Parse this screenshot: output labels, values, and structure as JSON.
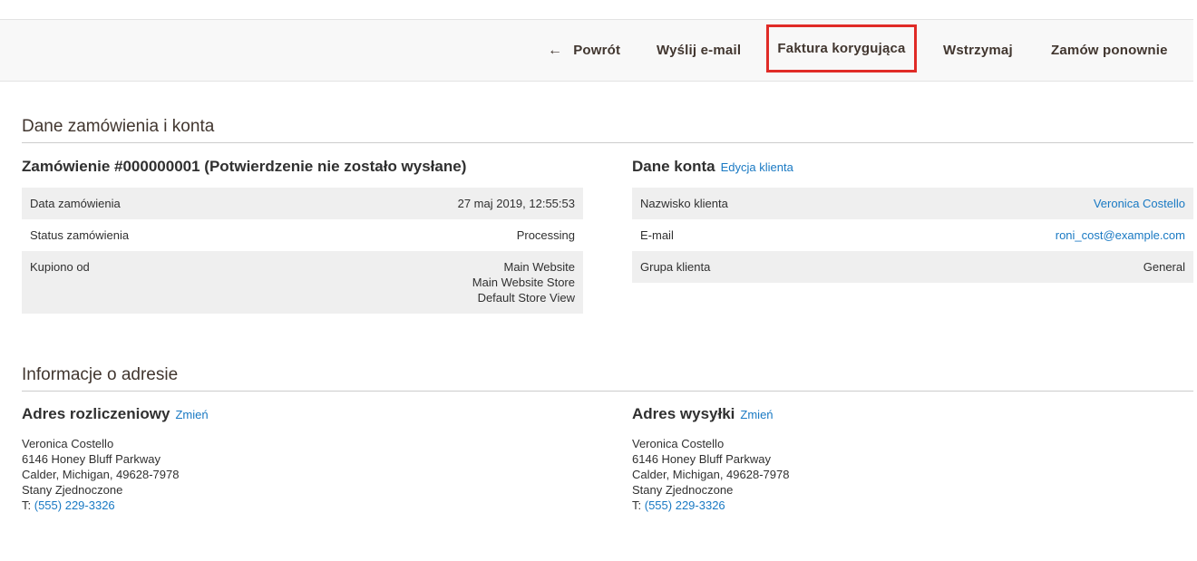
{
  "toolbar": {
    "back_label": "Powrót",
    "email_label": "Wyślij e-mail",
    "credit_memo_label": "Faktura korygująca",
    "hold_label": "Wstrzymaj",
    "reorder_label": "Zamów ponownie",
    "highlight_color": "#e02b27"
  },
  "order_account": {
    "section_title": "Dane zamówienia i konta",
    "order": {
      "title": "Zamówienie #000000001 (Potwierdzenie nie zostało wysłane)",
      "rows": [
        {
          "label": "Data zamówienia",
          "value": "27 maj 2019, 12:55:53"
        },
        {
          "label": "Status zamówienia",
          "value": "Processing"
        },
        {
          "label": "Kupiono od",
          "value_lines": [
            "Main Website",
            "Main Website Store",
            "Default Store View"
          ]
        }
      ]
    },
    "account": {
      "title": "Dane konta",
      "edit_link": "Edycja klienta",
      "rows": [
        {
          "label": "Nazwisko klienta",
          "value": "Veronica Costello"
        },
        {
          "label": "E-mail",
          "value": "roni_cost@example.com"
        },
        {
          "label": "Grupa klienta",
          "value": "General"
        }
      ]
    }
  },
  "address_info": {
    "section_title": "Informacje o adresie",
    "billing": {
      "title": "Adres rozliczeniowy",
      "edit_link": "Zmień",
      "lines": [
        "Veronica Costello",
        "6146 Honey Bluff Parkway",
        "Calder, Michigan, 49628-7978",
        "Stany Zjednoczone"
      ],
      "phone_prefix": "T:",
      "phone": "(555) 229-3326"
    },
    "shipping": {
      "title": "Adres wysyłki",
      "edit_link": "Zmień",
      "lines": [
        "Veronica Costello",
        "6146 Honey Bluff Parkway",
        "Calder, Michigan, 49628-7978",
        "Stany Zjednoczone"
      ],
      "phone_prefix": "T:",
      "phone": "(555) 229-3326"
    }
  },
  "colors": {
    "link": "#1979c3",
    "row_bg": "#efefef",
    "toolbar_bg": "#f8f8f8"
  }
}
